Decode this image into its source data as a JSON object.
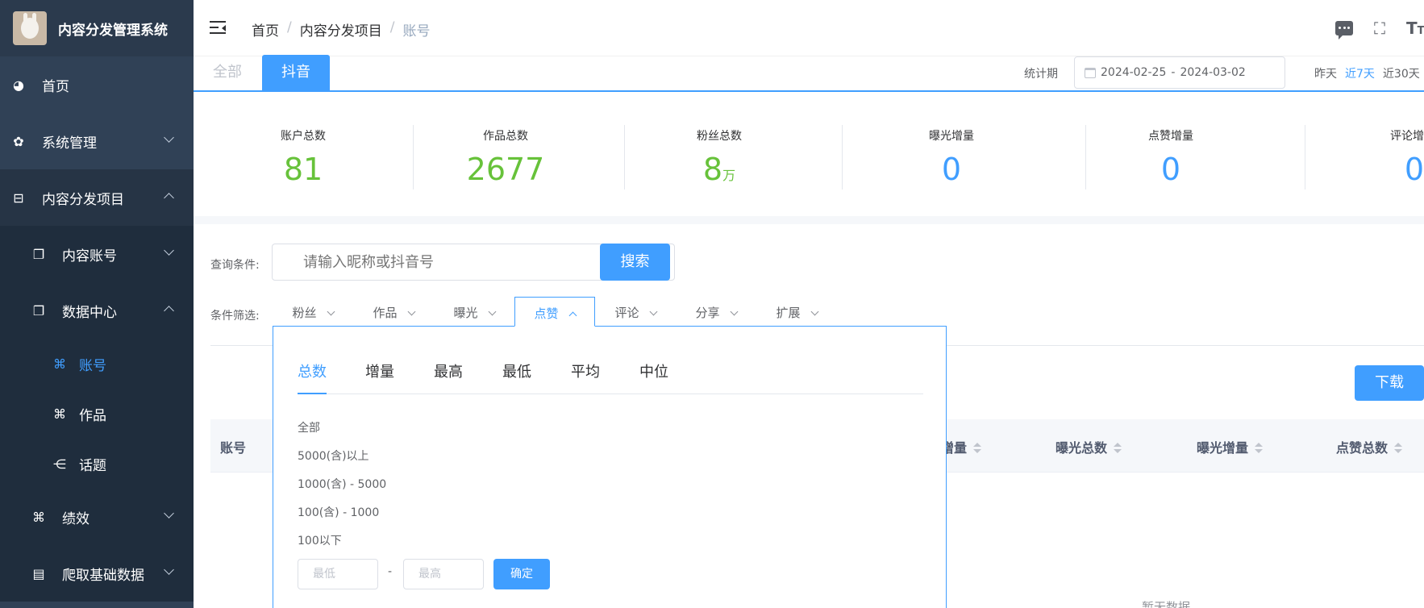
{
  "app": {
    "title": "内容分发管理系统"
  },
  "sidebar": {
    "items": [
      {
        "label": "首页",
        "icon": "dashboard-icon"
      },
      {
        "label": "系统管理",
        "icon": "gear-icon"
      },
      {
        "label": "内容分发项目",
        "icon": "briefcase-icon"
      },
      {
        "label": "内容账号",
        "icon": "documents-icon"
      },
      {
        "label": "数据中心",
        "icon": "documents-icon"
      },
      {
        "label": "账号",
        "icon": "puzzle-icon"
      },
      {
        "label": "作品",
        "icon": "puzzle-icon"
      },
      {
        "label": "话题",
        "icon": "tree-icon"
      },
      {
        "label": "绩效",
        "icon": "puzzle-icon"
      },
      {
        "label": "爬取基础数据",
        "icon": "table-icon"
      }
    ]
  },
  "breadcrumb": [
    "首页",
    "内容分发项目",
    "账号"
  ],
  "breadcrumb_sep": "/",
  "header_icons": [
    "message-icon",
    "fullscreen-icon",
    "font-size-icon"
  ],
  "platform_tabs": [
    "全部",
    "抖音"
  ],
  "period": {
    "label": "统计期",
    "start": "2024-02-25",
    "sep": "-",
    "end": "2024-03-02",
    "quick": [
      "昨天",
      "近7天",
      "近30天"
    ]
  },
  "stats": [
    {
      "label": "账户总数",
      "value": "81",
      "unit": "",
      "color": "#67c23a"
    },
    {
      "label": "作品总数",
      "value": "2677",
      "unit": "",
      "color": "#67c23a"
    },
    {
      "label": "粉丝总数",
      "value": "8",
      "unit": "万",
      "color": "#67c23a"
    },
    {
      "label": "曝光增量",
      "value": "0",
      "unit": "",
      "color": "#409eff"
    },
    {
      "label": "点赞增量",
      "value": "0",
      "unit": "",
      "color": "#409eff"
    },
    {
      "label": "评论增",
      "value": "0",
      "unit": "",
      "color": "#409eff"
    }
  ],
  "search": {
    "label": "查询条件:",
    "placeholder": "请输入昵称或抖音号",
    "button": "搜索"
  },
  "filters": {
    "label": "条件筛选:",
    "items": [
      "粉丝",
      "作品",
      "曝光",
      "点赞",
      "评论",
      "分享",
      "扩展"
    ]
  },
  "dropdown": {
    "tabs": [
      "总数",
      "增量",
      "最高",
      "最低",
      "平均",
      "中位"
    ],
    "options": [
      "全部",
      "5000(含)以上",
      "1000(含) - 5000",
      "100(含) - 1000",
      "100以下"
    ],
    "min_placeholder": "最低",
    "dash": "-",
    "max_placeholder": "最高",
    "confirm": "确定"
  },
  "download": "下载",
  "table": {
    "columns": [
      "账号",
      "增量",
      "曝光总数",
      "曝光增量",
      "点赞总数"
    ]
  },
  "empty_text": "暂无数据",
  "colors": {
    "accent": "#409eff",
    "success": "#67c23a",
    "sidebar": "#304156"
  }
}
